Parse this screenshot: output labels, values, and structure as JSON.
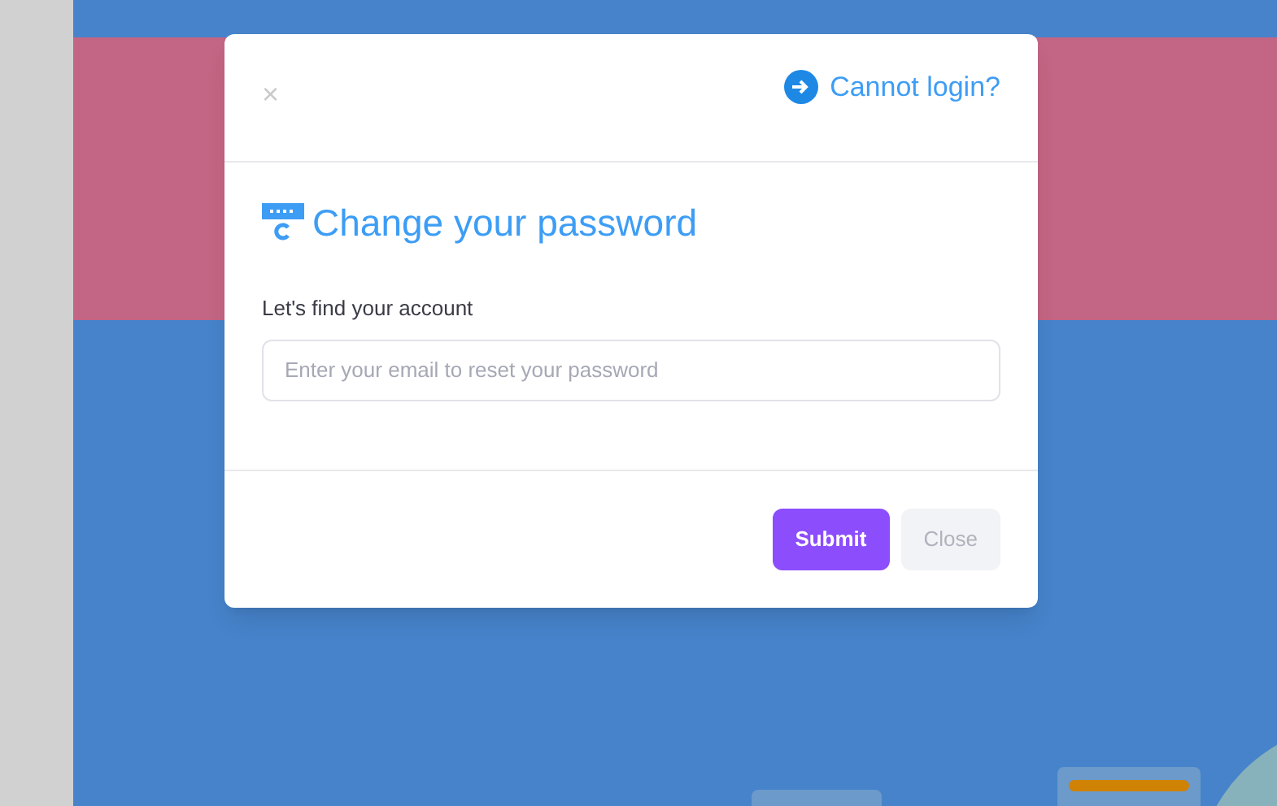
{
  "dialog": {
    "close_icon": "×",
    "help_link": "Cannot login?",
    "title": "Change your password",
    "field_label": "Let's find your account",
    "email_field": {
      "placeholder": "Enter your email to reset your password"
    },
    "buttons": [
      {
        "label": "Submit",
        "kind": "primary"
      },
      {
        "label": "Close",
        "kind": "secondary"
      }
    ]
  }
}
